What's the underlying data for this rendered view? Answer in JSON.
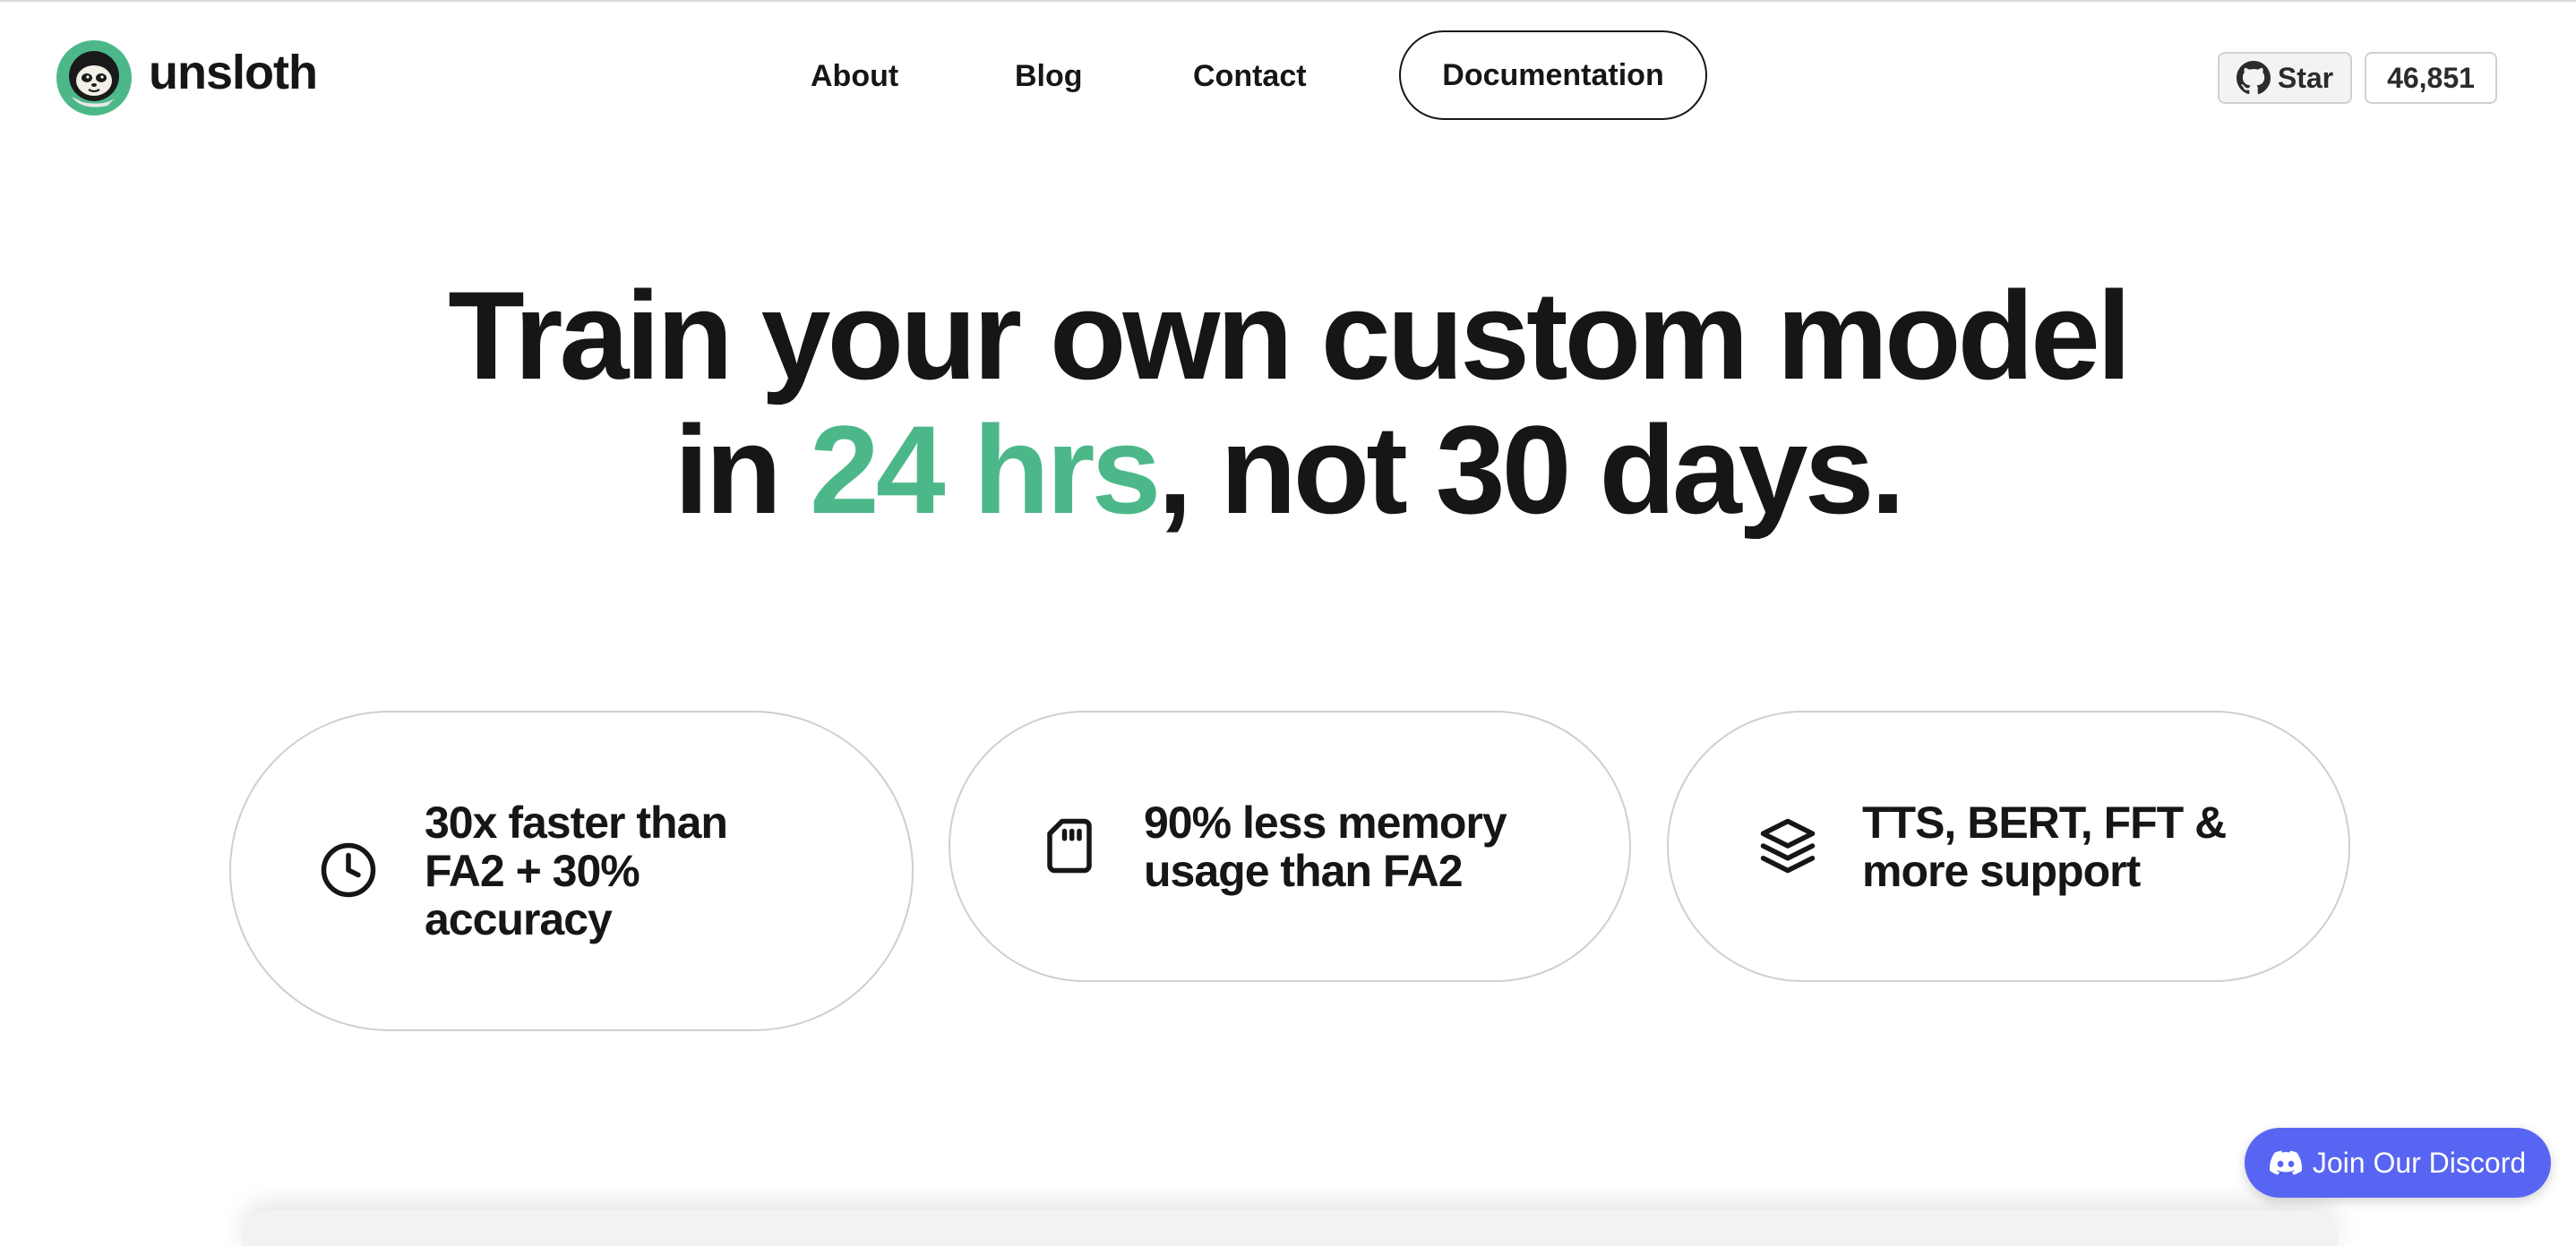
{
  "brand": {
    "name": "unsloth",
    "accent_color": "#4cb88a"
  },
  "nav": {
    "links": [
      "About",
      "Blog",
      "Contact"
    ],
    "cta": "Documentation"
  },
  "github": {
    "star_label": "Star",
    "star_count": "46,851",
    "icon": "github-icon"
  },
  "hero": {
    "line1": "Train your own custom model",
    "line2_prefix": "in ",
    "line2_accent": "24 hrs",
    "line2_suffix": ", not 30 days."
  },
  "features": [
    {
      "icon": "clock-icon",
      "text": "30x faster than FA2 + 30% accuracy"
    },
    {
      "icon": "memory-card-icon",
      "text": "90% less memory usage than FA2"
    },
    {
      "icon": "layers-icon",
      "text": "TTS, BERT, FFT & more  support"
    }
  ],
  "discord": {
    "label": "Join Our Discord",
    "color": "#5865f2",
    "icon": "discord-icon"
  }
}
